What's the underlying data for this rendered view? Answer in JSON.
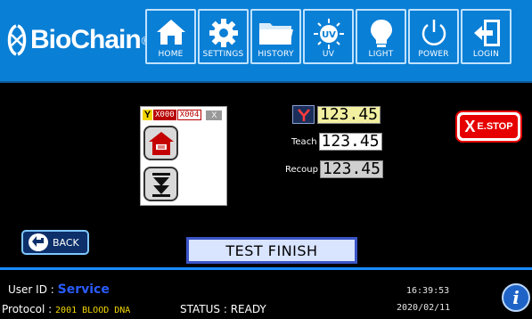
{
  "brand": {
    "name": "BioChain",
    "reg_mark": "®"
  },
  "nav": {
    "home": "HOME",
    "settings": "SETTINGS",
    "history": "HISTORY",
    "uv": "UV",
    "uv_badge": "UV",
    "light": "LIGHT",
    "power": "POWER",
    "login": "LOGIN"
  },
  "motor": {
    "axis_tab": "Y",
    "tabs": [
      "X000",
      "X004"
    ],
    "close": "X"
  },
  "readings": {
    "position": "123.45",
    "teach_label": "Teach",
    "teach": "123.45",
    "recoup_label": "Recoup",
    "recoup": "123.45"
  },
  "estop": {
    "label": "E.STOP",
    "icon": "X"
  },
  "back": {
    "label": "BACK"
  },
  "status_message": "TEST FINISH",
  "footer": {
    "user_label": "User ID",
    "user_value": "Service",
    "protocol_label": "Protocol",
    "protocol_value": "2001 BLOOD DNA",
    "status_label": "STATUS",
    "status_value": "READY",
    "time": "16:39:53",
    "date": "2020/02/11",
    "info": "i"
  },
  "colors": {
    "header": "#0a7fd6",
    "accent_blue": "#1a8cff",
    "estop": "#e60000",
    "highlight_yellow": "#f2d600",
    "user_blue": "#2a5cff"
  }
}
